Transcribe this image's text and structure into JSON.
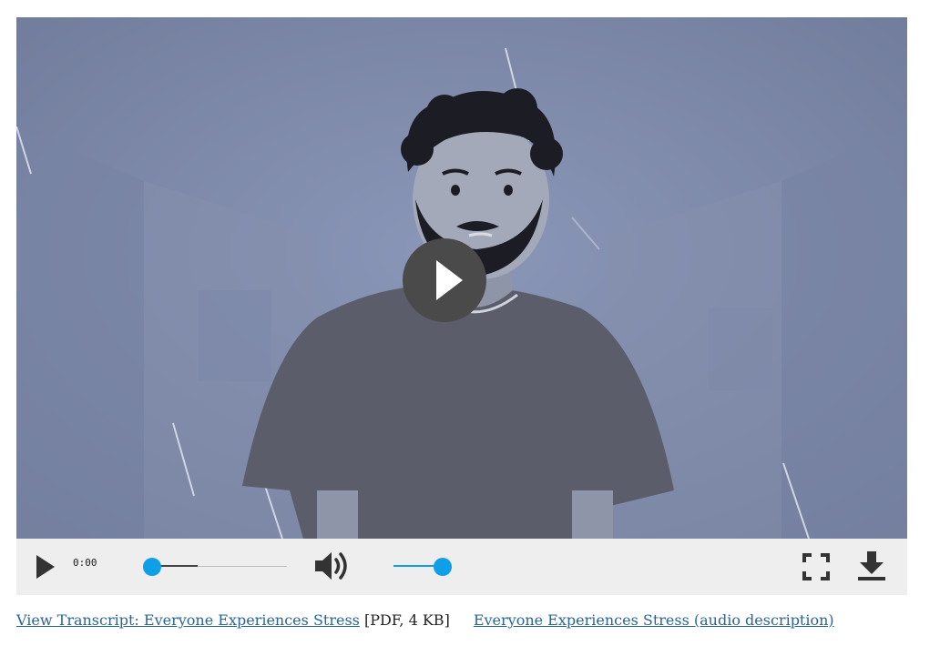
{
  "player": {
    "big_play_icon": "play-icon",
    "controls": {
      "play_icon": "play-icon",
      "current_time": "0:00",
      "progress": 0.0,
      "buffered": 0.32,
      "volume_icon": "speaker-volume-icon",
      "volume": 1.0,
      "fullscreen_icon": "fullscreen-icon",
      "download_icon": "download-icon"
    },
    "colors": {
      "accent": "#0f9ee8",
      "control_bar": "#eeeeee",
      "overlay_button": "#4a4a4a"
    }
  },
  "links": {
    "transcript_label": "View Transcript: Everyone Experiences Stress",
    "transcript_meta": "[PDF, 4 KB]",
    "audio_description_label": "Everyone Experiences Stress (audio description)"
  }
}
